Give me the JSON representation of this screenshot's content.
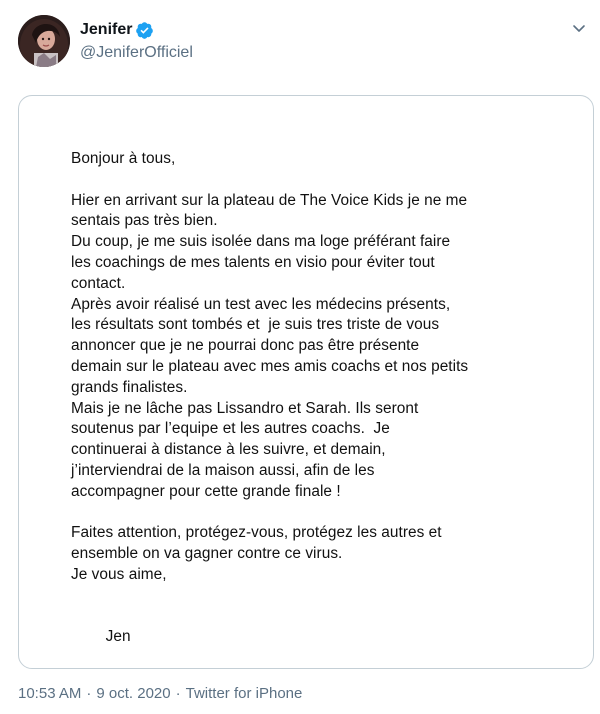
{
  "author": {
    "display_name": "Jenifer",
    "handle": "@JeniferOfficiel",
    "verified": true,
    "verified_color": "#1da1f2"
  },
  "icons": {
    "avatar": "profile-photo",
    "verified": "verified-badge-icon",
    "more": "chevron-down-icon",
    "sign_emoji": "kiss-mark-icon"
  },
  "letter": {
    "greeting": "Bonjour à tous,",
    "paragraph1": [
      "Hier en arrivant sur la plateau de The Voice Kids je ne me",
      "sentais pas très bien.",
      "Du coup, je me suis isolée dans ma loge préférant faire",
      "les coachings de mes talents en visio pour éviter tout",
      "contact.",
      "Après avoir réalisé un test avec les médecins présents,",
      "les résultats sont tombés et  je suis tres triste de vous",
      "annoncer que je ne pourrai donc pas être présente",
      "demain sur le plateau avec mes amis coachs et nos petits",
      "grands finalistes.",
      "Mais je ne lâche pas Lissandro et Sarah. Ils seront",
      "soutenus par l’equipe et les autres coachs.  Je",
      "continuerai à distance à les suivre, et demain,",
      "j’interviendrai de la maison aussi, afin de les",
      "accompagner pour cette grande finale !"
    ],
    "paragraph2": [
      "Faites attention, protégez-vous, protégez les autres et",
      "ensemble on va gagner contre ce virus.",
      "Je vous aime,"
    ],
    "signature": "Jen"
  },
  "meta": {
    "time": "10:53 AM",
    "separator": "·",
    "date": "9 oct. 2020",
    "source": "Twitter for iPhone"
  },
  "colors": {
    "secondary_text": "#5b7083",
    "card_border": "#c4cfd6",
    "kiss_red": "#d3183a"
  }
}
